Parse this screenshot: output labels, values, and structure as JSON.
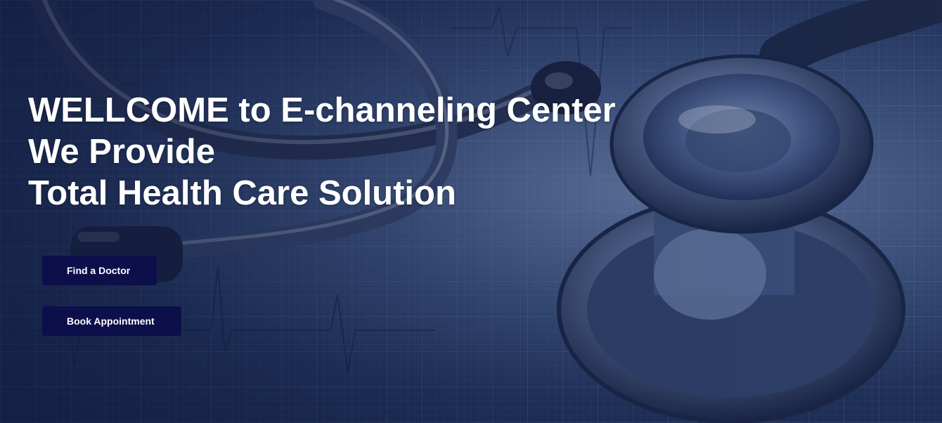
{
  "hero": {
    "background_icon": "stethoscope-on-ecg-chart",
    "headline_lines": [
      "WELLCOME to E-channeling Center",
      "We Provide",
      "Total Health Care Solution"
    ]
  },
  "buttons": {
    "find_doctor": "Find a Doctor",
    "book_appointment": "Book Appointment"
  },
  "colors": {
    "button_bg": "#0c0f49",
    "text": "#ffffff",
    "bg_dark": "#17254a",
    "bg_mid": "#3f5683"
  }
}
